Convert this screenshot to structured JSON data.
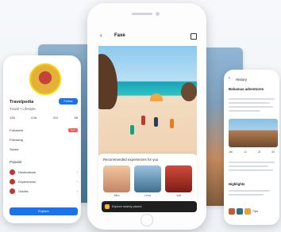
{
  "left_profile": {
    "name": "Travelpedia",
    "follow_label": "Follow",
    "subtitle": "Travel • Lifestyle",
    "stats": [
      "128",
      "4.5k",
      "312",
      "58"
    ],
    "rows": [
      {
        "label": "Followers",
        "value": "New"
      },
      {
        "label": "Following",
        "value": ""
      },
      {
        "label": "Saved",
        "value": ""
      }
    ],
    "section_title": "Popular",
    "items": [
      {
        "label": "Destinations"
      },
      {
        "label": "Experiences"
      },
      {
        "label": "Guides"
      }
    ],
    "primary_button": "Explore"
  },
  "center_app": {
    "title": "Faxe",
    "card_title": "Recommended experiences for you",
    "thumbs": [
      {
        "label": "Mira"
      },
      {
        "label": "Lena"
      },
      {
        "label": "Joel"
      }
    ],
    "bottom_bar_text": "Explore nearby places"
  },
  "right_detail": {
    "title": "History",
    "heading": "Bahamas adventures",
    "meta": [
      "Jan",
      "12",
      "24",
      "56"
    ],
    "subheading": "Highlights",
    "strip_text": "Trips"
  },
  "colors": {
    "accent": "#1a73e8",
    "dark_bar": "#1f1f1f",
    "avatar_ring": "#ffd100"
  }
}
